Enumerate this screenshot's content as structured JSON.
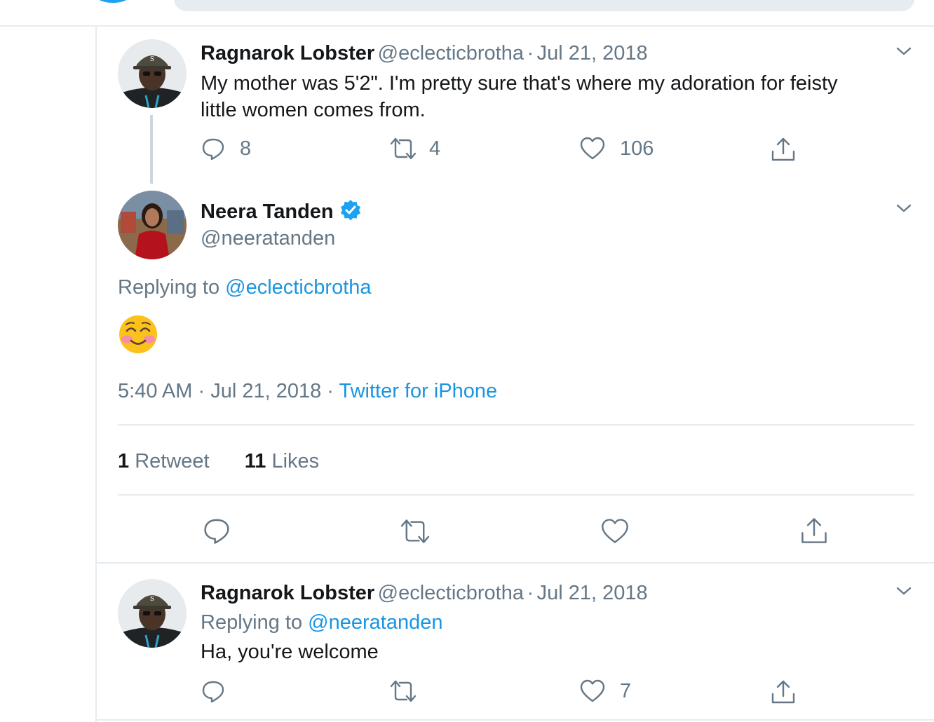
{
  "tweet1": {
    "name": "Ragnarok Lobster",
    "handle": "@eclecticbrotha",
    "sep": "·",
    "date": "Jul 21, 2018",
    "text_line1": "My mother was 5'2\". I'm pretty sure that's where my adoration for feisty",
    "text_line2": "little women comes from.",
    "replies": "8",
    "retweets": "4",
    "likes": "106"
  },
  "main_tweet": {
    "name": "Neera Tanden",
    "handle": "@neeratanden",
    "replying_prefix": "Replying to",
    "replying_to": "@eclecticbrotha",
    "content_emoji": "smiling-face-with-blush",
    "time": "5:40 AM",
    "sep1": "·",
    "date": "Jul 21, 2018",
    "sep2": "·",
    "source": "Twitter for iPhone",
    "retweet_count": "1",
    "retweet_label": "Retweet",
    "like_count": "11",
    "like_label": "Likes"
  },
  "tweet3": {
    "name": "Ragnarok Lobster",
    "handle": "@eclecticbrotha",
    "sep": "·",
    "date": "Jul 21, 2018",
    "replying_prefix": "Replying to",
    "replying_to": "@neeratanden",
    "text": "Ha, you're welcome",
    "likes": "7"
  },
  "colors": {
    "link": "#1b95e0",
    "muted": "#657786",
    "verified": "#1da1f2",
    "divider": "#e6ecf0"
  }
}
